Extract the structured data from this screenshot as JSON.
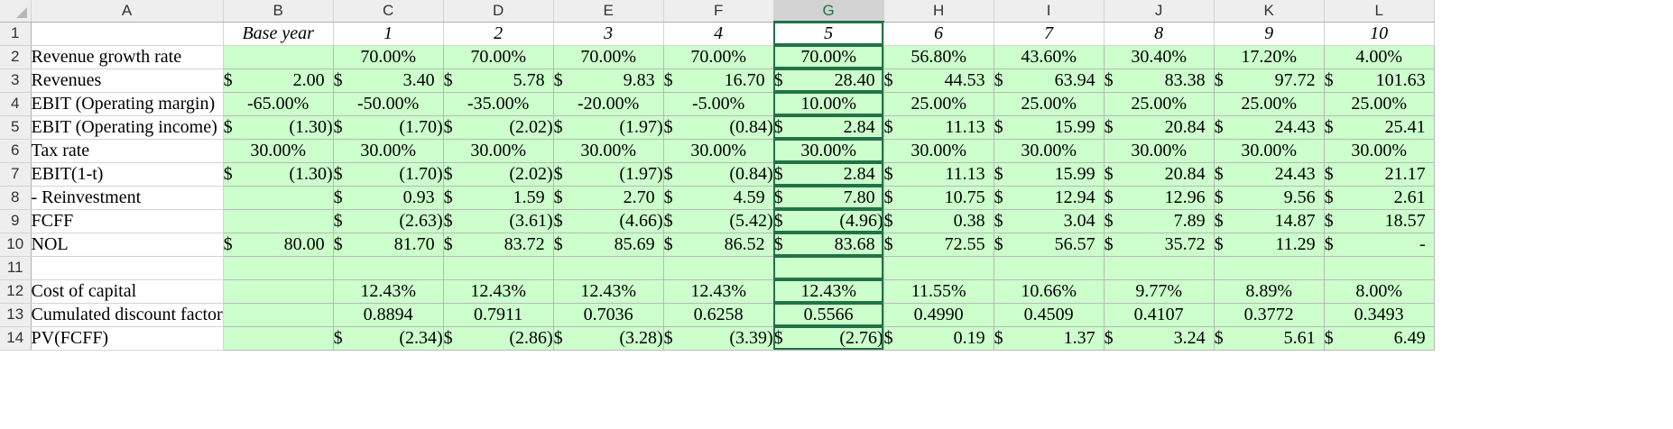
{
  "sheet": {
    "columns": [
      "A",
      "B",
      "C",
      "D",
      "E",
      "F",
      "G",
      "H",
      "I",
      "J",
      "K",
      "L"
    ],
    "selected_column": "G",
    "years_row": [
      "Base year",
      "1",
      "2",
      "3",
      "4",
      "5",
      "6",
      "7",
      "8",
      "9",
      "10"
    ],
    "rows": [
      {
        "num": "2",
        "label": "Revenue growth rate",
        "b": "",
        "vals": [
          "70.00%",
          "70.00%",
          "70.00%",
          "70.00%",
          "70.00%",
          "56.80%",
          "43.60%",
          "30.40%",
          "17.20%",
          "4.00%"
        ]
      },
      {
        "num": "3",
        "label": "Revenues",
        "b": "2.00",
        "vals": [
          "3.40",
          "5.78",
          "9.83",
          "16.70",
          "28.40",
          "44.53",
          "63.94",
          "83.38",
          "97.72",
          "101.63"
        ]
      },
      {
        "num": "4",
        "label": "EBIT (Operating margin)",
        "b": "-65.00%",
        "vals": [
          "-50.00%",
          "-35.00%",
          "-20.00%",
          "-5.00%",
          "10.00%",
          "25.00%",
          "25.00%",
          "25.00%",
          "25.00%",
          "25.00%"
        ]
      },
      {
        "num": "5",
        "label": "EBIT (Operating income)",
        "b": "(1.30)",
        "vals": [
          "(1.70)",
          "(2.02)",
          "(1.97)",
          "(0.84)",
          "2.84",
          "11.13",
          "15.99",
          "20.84",
          "24.43",
          "25.41"
        ]
      },
      {
        "num": "6",
        "label": "Tax rate",
        "b": "30.00%",
        "vals": [
          "30.00%",
          "30.00%",
          "30.00%",
          "30.00%",
          "30.00%",
          "30.00%",
          "30.00%",
          "30.00%",
          "30.00%",
          "30.00%"
        ]
      },
      {
        "num": "7",
        "label": "EBIT(1-t)",
        "b": "(1.30)",
        "vals": [
          "(1.70)",
          "(2.02)",
          "(1.97)",
          "(0.84)",
          "2.84",
          "11.13",
          "15.99",
          "20.84",
          "24.43",
          "21.17"
        ]
      },
      {
        "num": "8",
        "label": " - Reinvestment",
        "b": "",
        "vals": [
          "0.93",
          "1.59",
          "2.70",
          "4.59",
          "7.80",
          "10.75",
          "12.94",
          "12.96",
          "9.56",
          "2.61"
        ]
      },
      {
        "num": "9",
        "label": "FCFF",
        "b": "",
        "vals": [
          "(2.63)",
          "(3.61)",
          "(4.66)",
          "(5.42)",
          "(4.96)",
          "0.38",
          "3.04",
          "7.89",
          "14.87",
          "18.57"
        ]
      },
      {
        "num": "10",
        "label": "NOL",
        "b": "80.00",
        "vals": [
          "81.70",
          "83.72",
          "85.69",
          "86.52",
          "83.68",
          "72.55",
          "56.57",
          "35.72",
          "11.29",
          "-"
        ]
      },
      {
        "num": "11",
        "label": "",
        "b": "",
        "vals": [
          "",
          "",
          "",
          "",
          "",
          "",
          "",
          "",
          "",
          ""
        ]
      },
      {
        "num": "12",
        "label": "Cost of capital",
        "b": "",
        "vals": [
          "12.43%",
          "12.43%",
          "12.43%",
          "12.43%",
          "12.43%",
          "11.55%",
          "10.66%",
          "9.77%",
          "8.89%",
          "8.00%"
        ]
      },
      {
        "num": "13",
        "label": "Cumulated discount factor",
        "b": "",
        "vals": [
          "0.8894",
          "0.7911",
          "0.7036",
          "0.6258",
          "0.5566",
          "0.4990",
          "0.4509",
          "0.4107",
          "0.3772",
          "0.3493"
        ]
      },
      {
        "num": "14",
        "label": "PV(FCFF)",
        "b": "",
        "vals": [
          "(2.34)",
          "(2.86)",
          "(3.28)",
          "(3.39)",
          "(2.76)",
          "0.19",
          "1.37",
          "3.24",
          "5.61",
          "6.49"
        ]
      }
    ],
    "currency_symbol": "$",
    "colors": {
      "fill": "#ccffcc",
      "selected": "#217346"
    }
  }
}
